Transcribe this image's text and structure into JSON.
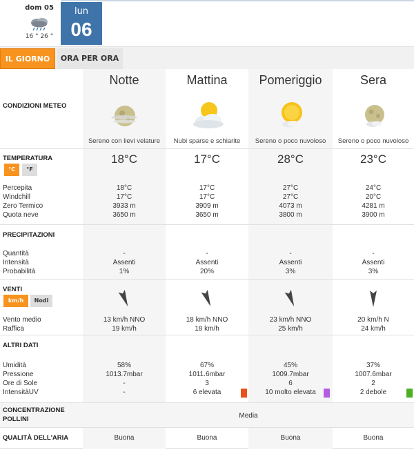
{
  "days": {
    "prev": {
      "label": "dom 05",
      "temps": "16 ° 26 °",
      "icon": "rain-cloud-icon"
    },
    "current": {
      "label": "lun",
      "number": "06"
    }
  },
  "tabs": {
    "day": "IL GIORNO",
    "hourly": "ORA PER ORA"
  },
  "sections": {
    "conditions": "CONDIZIONI METEO",
    "temperature": "TEMPERATURA",
    "precipitation": "PRECIPITAZIONI",
    "wind": "VENTI",
    "other": "ALTRI DATI",
    "pollen_line1": "CONCENTRAZIONE",
    "pollen_line2": "POLLINI",
    "air": "QUALITÀ DELL'ARIA"
  },
  "units": {
    "celsius": "°C",
    "fahrenheit": "°F",
    "kmh": "km/h",
    "knots": "Nodi"
  },
  "labels": {
    "feels": "Percepita",
    "windchill": "Windchill",
    "freezing": "Zero Termico",
    "snow": "Quota neve",
    "quantity": "Quantità",
    "intensity": "Intensità",
    "probability": "Probabilità",
    "wind_avg": "Vento medio",
    "gust": "Raffica",
    "humidity": "Umidità",
    "pressure": "Pressione",
    "sun_hours": "Ore di Sole",
    "uv": "IntensitàUV"
  },
  "pollen_value": "Media",
  "colors": {
    "accent": "#f7931e",
    "day_blue": "#3f74ab"
  },
  "periods": [
    {
      "name": "Notte",
      "icon": "moon-hazy-icon",
      "desc": "Sereno con lievi velature",
      "temp": "18°C",
      "feels": "18°C",
      "windchill": "17°C",
      "freezing": "3933 m",
      "snow": "3650 m",
      "quantity": "-",
      "intensity": "Assenti",
      "probability": "1%",
      "wind_dir": "NNO",
      "wind_avg": "13 km/h  NNO",
      "gust": "19 km/h",
      "humidity": "58%",
      "pressure": "1013.7mbar",
      "sun_hours": "-",
      "uv": "-",
      "uv_color": "",
      "air": "Buona"
    },
    {
      "name": "Mattina",
      "icon": "sun-cloud-icon",
      "desc": "Nubi sparse e schiarite",
      "temp": "17°C",
      "feels": "17°C",
      "windchill": "17°C",
      "freezing": "3909 m",
      "snow": "3650 m",
      "quantity": "-",
      "intensity": "Assenti",
      "probability": "20%",
      "wind_dir": "NNO",
      "wind_avg": "18 km/h NNO",
      "gust": "18 km/h",
      "humidity": "67%",
      "pressure": "1011.6mbar",
      "sun_hours": "3",
      "uv": "6 elevata",
      "uv_color": "#e8501c",
      "air": "Buona"
    },
    {
      "name": "Pomeriggio",
      "icon": "sun-small-cloud-icon",
      "desc": "Sereno o poco nuvoloso",
      "temp": "28°C",
      "feels": "27°C",
      "windchill": "27°C",
      "freezing": "4073 m",
      "snow": "3800 m",
      "quantity": "-",
      "intensity": "Assenti",
      "probability": "3%",
      "wind_dir": "NNO",
      "wind_avg": "23 km/h NNO",
      "gust": "25 km/h",
      "humidity": "45%",
      "pressure": "1009.7mbar",
      "sun_hours": "6",
      "uv": "10 molto elevata",
      "uv_color": "#b35ce0",
      "air": "Buona"
    },
    {
      "name": "Sera",
      "icon": "moon-small-cloud-icon",
      "desc": "Sereno o poco nuvoloso",
      "temp": "23°C",
      "feels": "24°C",
      "windchill": "20°C",
      "freezing": "4281 m",
      "snow": "3900 m",
      "quantity": "-",
      "intensity": "Assenti",
      "probability": "3%",
      "wind_dir": "N",
      "wind_avg": "20 km/h N",
      "gust": "24 km/h",
      "humidity": "37%",
      "pressure": "1007.6mbar",
      "sun_hours": "2",
      "uv": "2 debole",
      "uv_color": "#4caf24",
      "air": "Buona"
    }
  ]
}
